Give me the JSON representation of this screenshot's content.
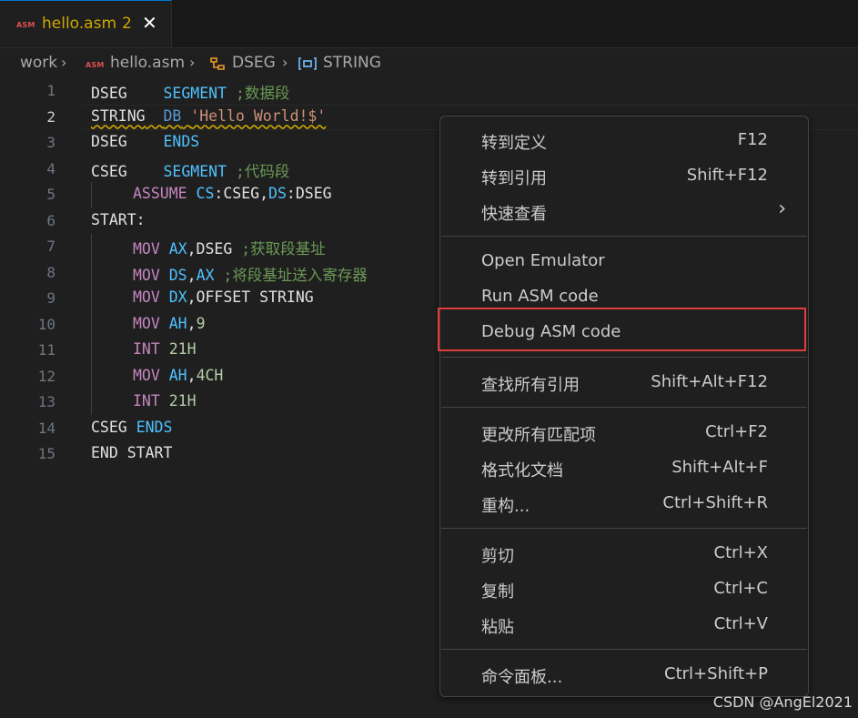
{
  "tab": {
    "badge": "ASM",
    "title": "hello.asm",
    "count": "2",
    "close": "✕"
  },
  "breadcrumb": {
    "root": "work",
    "badge": "ASM",
    "file": "hello.asm",
    "seg": "DSEG",
    "sym": "STRING",
    "seg_icon": "symbol-namespace-icon",
    "sym_icon": "symbol-variable-icon"
  },
  "lines": [
    {
      "n": "1"
    },
    {
      "n": "2"
    },
    {
      "n": "3"
    },
    {
      "n": "4"
    },
    {
      "n": "5"
    },
    {
      "n": "6"
    },
    {
      "n": "7"
    },
    {
      "n": "8"
    },
    {
      "n": "9"
    },
    {
      "n": "10"
    },
    {
      "n": "11"
    },
    {
      "n": "12"
    },
    {
      "n": "13"
    },
    {
      "n": "14"
    },
    {
      "n": "15"
    }
  ],
  "code": {
    "l1": {
      "a": "DSEG",
      "b": "SEGMENT",
      "c": ";数据段"
    },
    "l2": {
      "a": "STRING",
      "b": "DB",
      "c": "'Hello World!$'"
    },
    "l3": {
      "a": "DSEG",
      "b": "ENDS"
    },
    "l4": {
      "a": "CSEG",
      "b": "SEGMENT",
      "c": ";代码段"
    },
    "l5": {
      "a": "ASSUME",
      "b": "CS",
      "c": ":CSEG,",
      "d": "DS",
      "e": ":DSEG"
    },
    "l6": {
      "a": "START:"
    },
    "l7": {
      "a": "MOV",
      "b": "AX",
      "c": ",DSEG",
      "d": ";获取段基址"
    },
    "l8": {
      "a": "MOV",
      "b": "DS",
      "c": ",",
      "d": "AX",
      "e": ";将段基址送入寄存器"
    },
    "l9": {
      "a": "MOV",
      "b": "DX",
      "c": ",OFFSET STRING"
    },
    "l10": {
      "a": "MOV",
      "b": "AH",
      "c": ",",
      "d": "9"
    },
    "l11": {
      "a": "INT",
      "b": "21H"
    },
    "l12": {
      "a": "MOV",
      "b": "AH",
      "c": ",",
      "d": "4CH"
    },
    "l13": {
      "a": "INT",
      "b": "21H"
    },
    "l14": {
      "a": "CSEG",
      "b": "ENDS"
    },
    "l15": {
      "a": "END START"
    }
  },
  "menu": [
    {
      "label": "转到定义",
      "key": "F12"
    },
    {
      "label": "转到引用",
      "key": "Shift+F12"
    },
    {
      "label": "快速查看",
      "key": "",
      "arrow": "›"
    },
    {
      "label": "Open Emulator",
      "key": ""
    },
    {
      "label": "Run ASM code",
      "key": ""
    },
    {
      "label": "Debug ASM code",
      "key": ""
    },
    {
      "label": "查找所有引用",
      "key": "Shift+Alt+F12"
    },
    {
      "label": "更改所有匹配项",
      "key": "Ctrl+F2"
    },
    {
      "label": "格式化文档",
      "key": "Shift+Alt+F"
    },
    {
      "label": "重构...",
      "key": "Ctrl+Shift+R"
    },
    {
      "label": "剪切",
      "key": "Ctrl+X"
    },
    {
      "label": "复制",
      "key": "Ctrl+C"
    },
    {
      "label": "粘贴",
      "key": "Ctrl+V"
    },
    {
      "label": "命令面板...",
      "key": "Ctrl+Shift+P"
    }
  ],
  "watermark": "CSDN @AngEl2021",
  "colors": {
    "accent": "#0078d4",
    "warning": "#cca700",
    "highlight": "#e03c3c"
  }
}
